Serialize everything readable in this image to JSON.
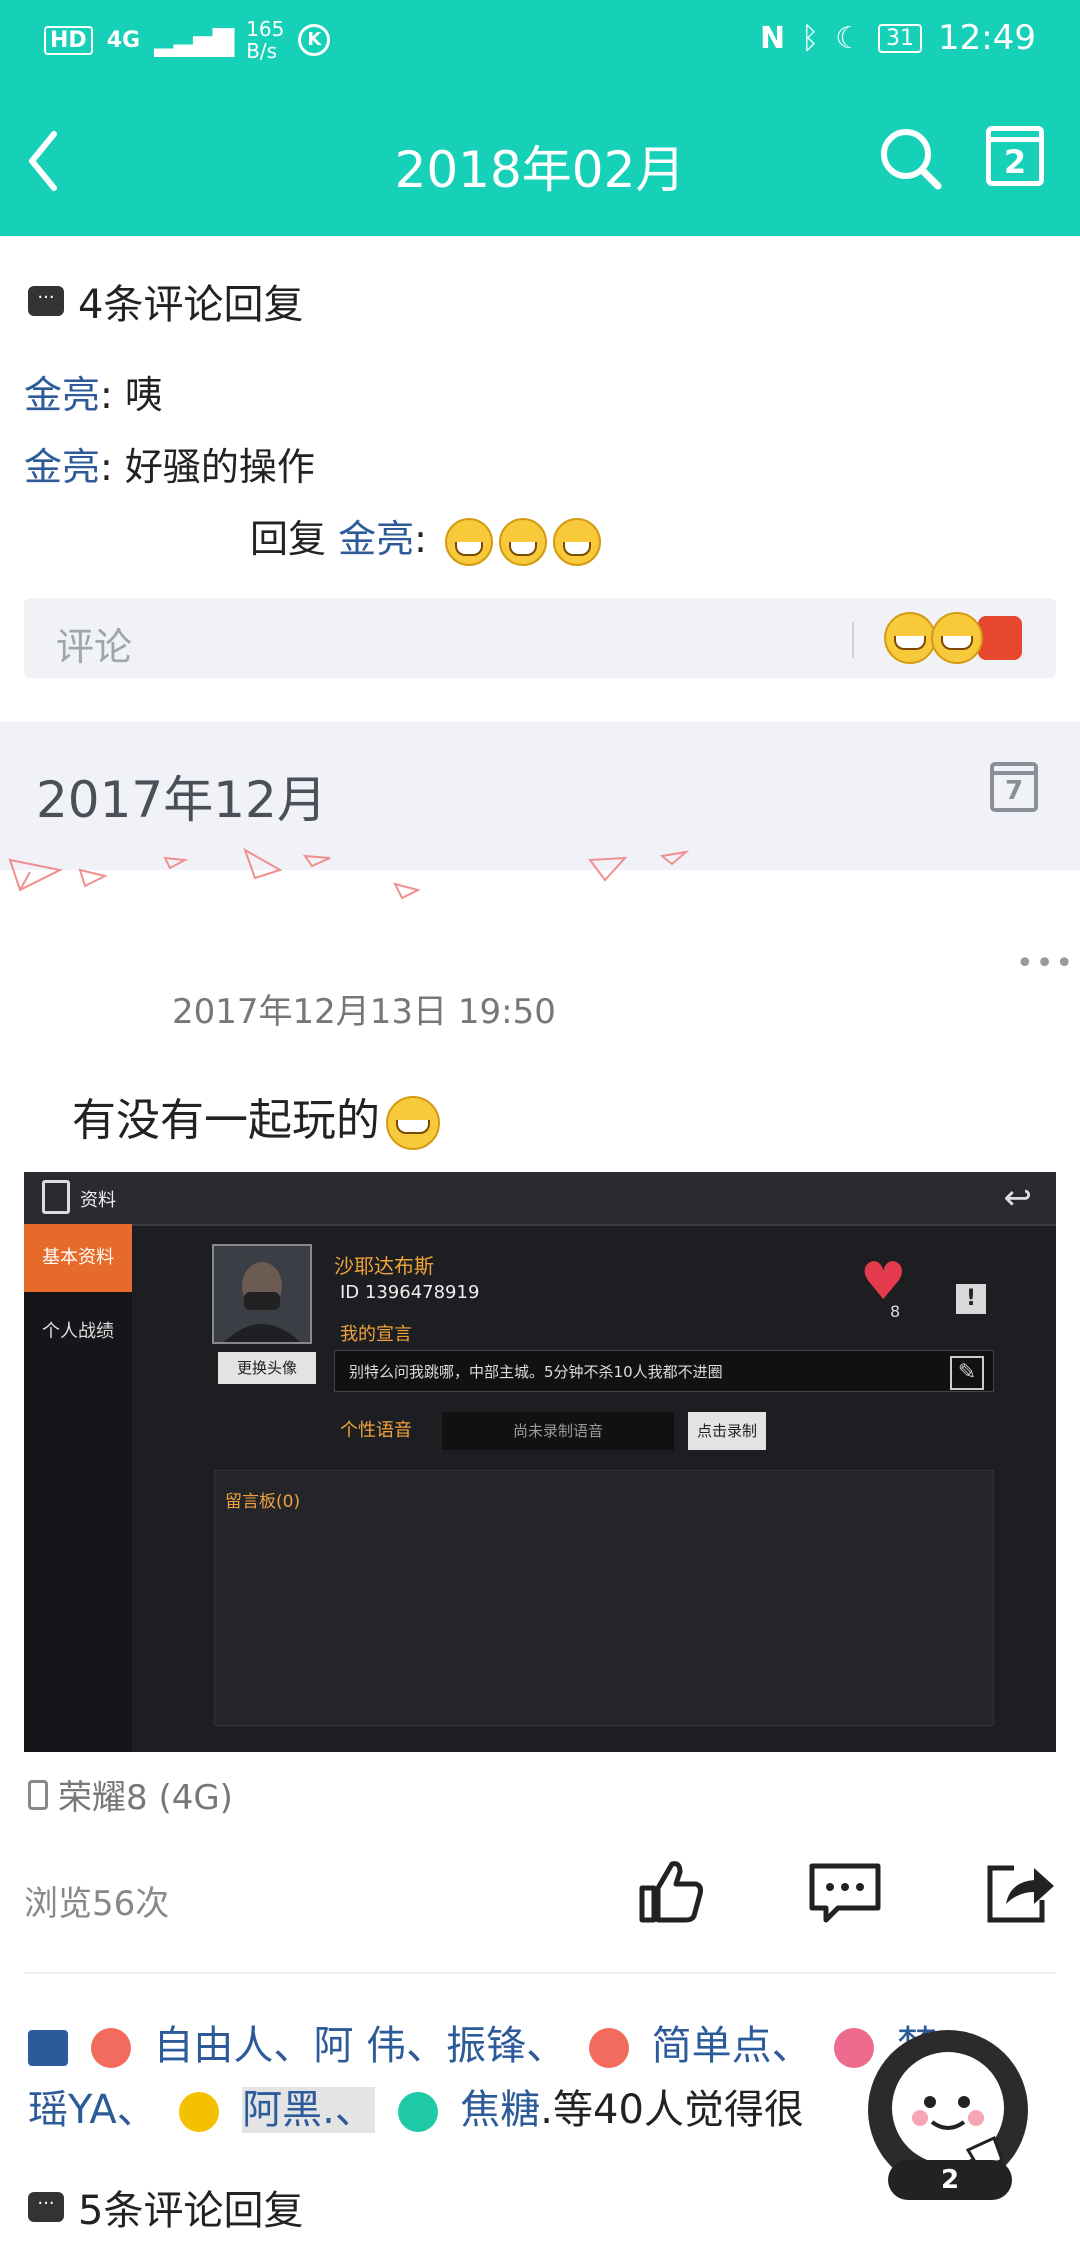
{
  "status_bar": {
    "network": "4G",
    "speed": "165\nB/s",
    "battery": "31",
    "time": "12:49"
  },
  "header": {
    "title": "2018年02月",
    "back_icon": "chevron-left-icon",
    "search_icon": "search-icon",
    "calendar_icon": "calendar-icon",
    "calendar_day": "2"
  },
  "comments_prev": {
    "title": "4条评论回复",
    "items": [
      {
        "name": "金亮",
        "text": ": 咦"
      },
      {
        "name": "金亮",
        "text": ": 好骚的操作"
      },
      {
        "prefix": "回复 ",
        "name": "金亮",
        "text": ":"
      }
    ],
    "placeholder": "评论"
  },
  "month_band": {
    "label": "2017年12月",
    "calendar_day": "7"
  },
  "post": {
    "datetime": "2017年12月13日 19:50",
    "text": "有没有一起玩的",
    "device": "荣耀8 (4G)",
    "views": "浏览56次",
    "screenshot": {
      "title": "资料",
      "tab_basic": "基本资料",
      "tab_stats": "个人战绩",
      "player_name": "沙耶达布斯",
      "player_id": "ID 1396478919",
      "declaration_label": "我的宣言",
      "change_avatar": "更换头像",
      "declaration": "别特么问我跳哪，中部主城。5分钟不杀10人我都不进圈",
      "voice_label": "个性语音",
      "voice_status": "尚未录制语音",
      "record_btn": "点击录制",
      "board_label": "留言板(0)",
      "likes_count": "8"
    },
    "likes": {
      "names": [
        "自由人、",
        "阿 伟、",
        "振锋、",
        "简单点、",
        "梦",
        "瑶YA、",
        "阿黑.、",
        "焦糖"
      ],
      "suffix": ".等40人觉得很"
    },
    "comments_title": "5条评论回复"
  },
  "mascot": {
    "badge": "2"
  },
  "colors": {
    "accent": "#16d0b8",
    "link": "#2d5b9a"
  }
}
